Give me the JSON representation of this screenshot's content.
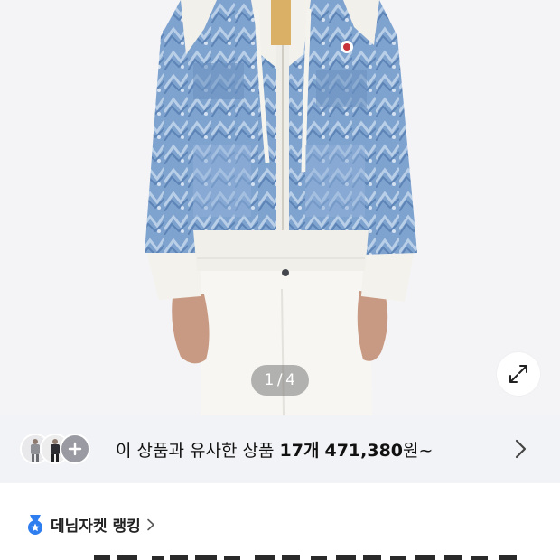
{
  "gallery": {
    "pager": {
      "current": "1",
      "separator": "/",
      "total": "4"
    },
    "expand_icon": "expand-arrows-icon"
  },
  "similar": {
    "prefix": "이 상품과 유사한 상품",
    "count": "17개",
    "price_number": "471,380",
    "price_suffix": "원~",
    "more_icon": "chevron-right-icon",
    "plus_icon": "plus-icon"
  },
  "ranking": {
    "label": "데님자켓 랭킹",
    "icon": "medal-icon",
    "chevron_icon": "chevron-right-icon",
    "accent_color": "#2f7ef0"
  },
  "colors": {
    "bar_background": "#f2f3f6",
    "image_background": "#f4f4f6"
  }
}
